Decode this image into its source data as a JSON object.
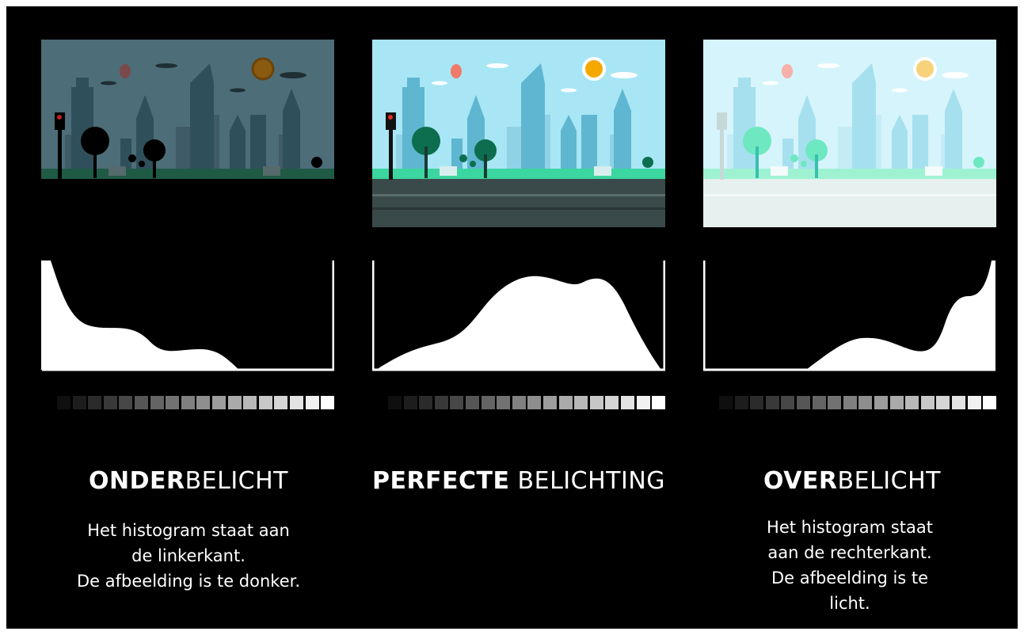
{
  "panels": [
    {
      "id": "under",
      "title_bold": "ONDER",
      "title_light": "BELICHT",
      "desc_lines": [
        "Het histogram staat aan",
        "de linkerkant.",
        "De afbeelding is te donker."
      ],
      "exposure": "dark",
      "histogram_shape": "peaks-left"
    },
    {
      "id": "perfect",
      "title_bold": "PERFECTE",
      "title_light": " BELICHTING",
      "desc_lines": [],
      "exposure": "normal",
      "histogram_shape": "centered"
    },
    {
      "id": "over",
      "title_bold": "OVER",
      "title_light": "BELICHT",
      "desc_lines": [
        "Het histogram staat",
        "aan de rechterkant.",
        "De afbeelding is te",
        "licht."
      ],
      "exposure": "bright",
      "histogram_shape": "peaks-right"
    }
  ],
  "tone_strip_steps": 18,
  "colors": {
    "background": "#000000",
    "histogram_fill": "#ffffff",
    "sun_dark": "#8a5a10",
    "sun_normal": "#f5a800",
    "sun_bright": "#f7d27a"
  }
}
